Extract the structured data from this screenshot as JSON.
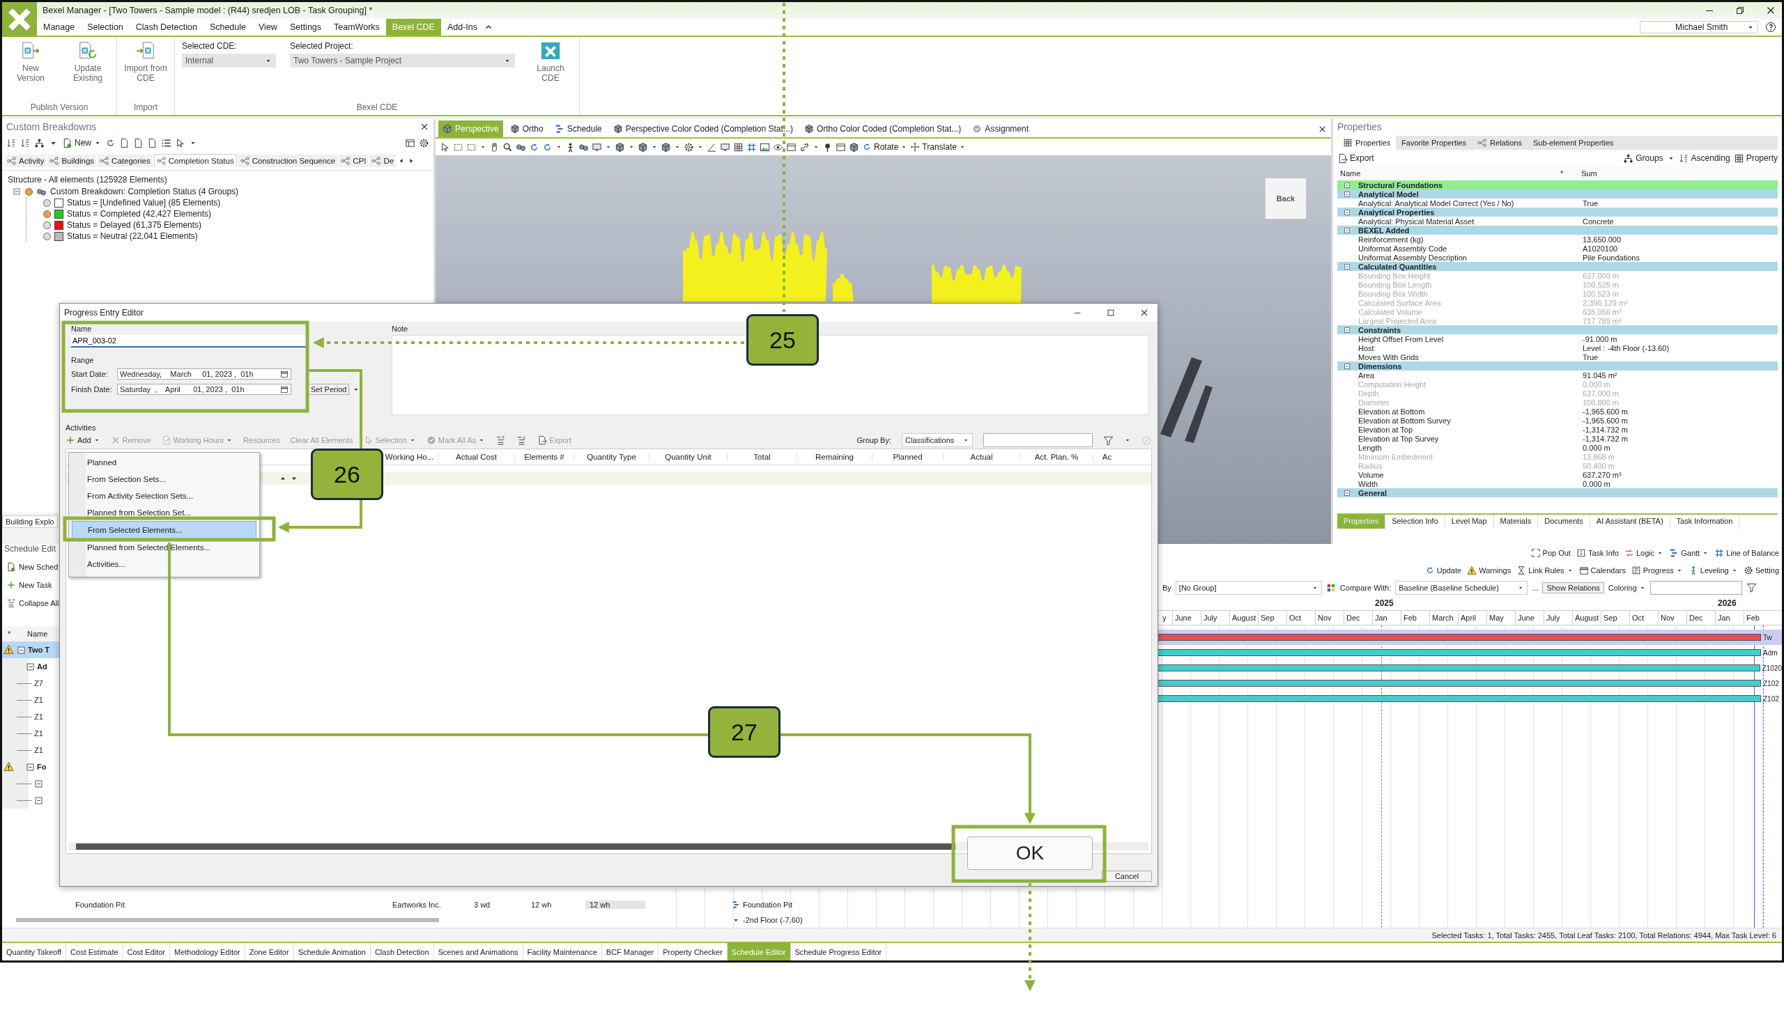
{
  "window": {
    "title": "Bexel Manager - [Two Towers - Sample model : (R44) sredjen LOB  - Task Grouping] *",
    "user": "Michael Smith"
  },
  "menu": [
    {
      "label": "Manage",
      "selected": false
    },
    {
      "label": "Selection",
      "selected": false
    },
    {
      "label": "Clash Detection",
      "selected": false
    },
    {
      "label": "Schedule",
      "selected": false
    },
    {
      "label": "View",
      "selected": false
    },
    {
      "label": "Settings",
      "selected": false
    },
    {
      "label": "TeamWorks",
      "selected": false
    },
    {
      "label": "Bexel CDE",
      "selected": true
    },
    {
      "label": "Add-Ins",
      "selected": false
    }
  ],
  "ribbon": [
    {
      "label": "Publish Version",
      "buttons": [
        {
          "label": "New Version",
          "kind": "new"
        },
        {
          "label": "Update Existing",
          "kind": "update"
        }
      ]
    },
    {
      "label": "Import",
      "buttons": [
        {
          "label": "Import from CDE",
          "kind": "import"
        }
      ]
    },
    {
      "label": "Bexel CDE",
      "fields": [
        {
          "label": "Selected CDE:",
          "value": "Internal",
          "disabled": true
        },
        {
          "label": "Selected Project:",
          "value": "Two Towers - Sample Project",
          "disabled": true
        }
      ],
      "buttons": [
        {
          "label": "Launch CDE",
          "kind": "launch"
        }
      ]
    }
  ],
  "breakdowns": {
    "title": "Custom Breakdowns",
    "new_label": "New",
    "tabs": [
      {
        "label": "Activity",
        "selected": false
      },
      {
        "label": "Buildings",
        "selected": false
      },
      {
        "label": "Categories",
        "selected": false
      },
      {
        "label": "Completion Status",
        "selected": true
      },
      {
        "label": "Construction Sequence",
        "selected": false
      },
      {
        "label": "CPI",
        "selected": false
      },
      {
        "label": "De",
        "selected": false
      }
    ],
    "structure": "Structure - All elements (125928 Elements)",
    "tree": [
      {
        "label": "Custom Breakdown: Completion Status (4 Groups)",
        "visible": true,
        "expanded": true,
        "children": [
          {
            "label": "Status = [Undefined Value] (85 Elements)",
            "visible": false,
            "color": "#ffffff"
          },
          {
            "label": "Status = Completed (42,427 Elements)",
            "visible": true,
            "color": "#22cc22"
          },
          {
            "label": "Status = Delayed (61,375 Elements)",
            "visible": false,
            "color": "#ee1111"
          },
          {
            "label": "Status = Neutral (22,041 Elements)",
            "visible": false,
            "color": "#bbbbbb"
          }
        ]
      }
    ]
  },
  "viewport": {
    "tabs": [
      {
        "label": "Perspective",
        "selected": true
      },
      {
        "label": "Ortho",
        "selected": false
      },
      {
        "label": "Schedule",
        "selected": false
      },
      {
        "label": "Perspective Color Coded (Completion Stat...)",
        "selected": false
      },
      {
        "label": "Ortho Color Coded (Completion Stat...)",
        "selected": false
      },
      {
        "label": "Assignment",
        "selected": false
      }
    ],
    "tools": [
      "Rotate",
      "Translate"
    ],
    "view_cube": "Back"
  },
  "properties": {
    "title": "Properties",
    "tabs": [
      {
        "label": "Properties",
        "selected": true
      },
      {
        "label": "Favorite Properties",
        "selected": false
      },
      {
        "label": "Relations",
        "selected": false
      },
      {
        "label": "Sub-element Properties",
        "selected": false
      }
    ],
    "export": "Export",
    "groups": "Groups",
    "ascending": "Ascending",
    "property": "Property",
    "columns": [
      "Name",
      "*",
      "Sum"
    ],
    "rows": [
      {
        "kind": "category",
        "name": "Structural Foundations"
      },
      {
        "kind": "group",
        "name": "Analytical Model"
      },
      {
        "kind": "value",
        "name": "Analytical: Analytical Model Correct (Yes / No)",
        "value": "True",
        "disabled": false
      },
      {
        "kind": "group",
        "name": "Analytical Properties"
      },
      {
        "kind": "value",
        "name": "Analytical: Physical Material Asset",
        "value": "Concrete",
        "disabled": false
      },
      {
        "kind": "group",
        "name": "BEXEL Added"
      },
      {
        "kind": "value",
        "name": "Reinforcement (kg)",
        "value": "13,650.000",
        "disabled": false
      },
      {
        "kind": "value",
        "name": "Uniformat Assembly Code",
        "value": "A1020100",
        "disabled": false
      },
      {
        "kind": "value",
        "name": "Uniformat Assembly Description",
        "value": "Pile Foundations",
        "disabled": false
      },
      {
        "kind": "group",
        "name": "Calculated Quantities"
      },
      {
        "kind": "value",
        "name": "Bounding Box Height",
        "value": "637.000 m",
        "disabled": true
      },
      {
        "kind": "value",
        "name": "Bounding Box Length",
        "value": "100.525 m",
        "disabled": true
      },
      {
        "kind": "value",
        "name": "Bounding Box Width",
        "value": "100.523 m",
        "disabled": true
      },
      {
        "kind": "value",
        "name": "Calculated Surface Area",
        "value": "2,396.129 m²",
        "disabled": true
      },
      {
        "kind": "value",
        "name": "Calculated Volume",
        "value": "635.056 m³",
        "disabled": true
      },
      {
        "kind": "value",
        "name": "Largest Projected Area",
        "value": "717.789 m²",
        "disabled": true
      },
      {
        "kind": "group",
        "name": "Constraints"
      },
      {
        "kind": "value",
        "name": "Height Offset From Level",
        "value": "-91.000 m",
        "disabled": false
      },
      {
        "kind": "value",
        "name": "Host",
        "value": "Level : -4th Floor (-13.60)",
        "disabled": false
      },
      {
        "kind": "value",
        "name": "Moves With Grids",
        "value": "True",
        "disabled": false
      },
      {
        "kind": "group",
        "name": "Dimensions"
      },
      {
        "kind": "value",
        "name": "Area",
        "value": "91.045 m²",
        "disabled": false
      },
      {
        "kind": "value",
        "name": "Computation Height",
        "value": "0.000 m",
        "disabled": true
      },
      {
        "kind": "value",
        "name": "Depth",
        "value": "637.000 m",
        "disabled": true
      },
      {
        "kind": "value",
        "name": "Diameter",
        "value": "100.800 m",
        "disabled": true
      },
      {
        "kind": "value",
        "name": "Elevation at Bottom",
        "value": "-1,965.600 m",
        "disabled": false
      },
      {
        "kind": "value",
        "name": "Elevation at Bottom Survey",
        "value": "-1,965.600 m",
        "disabled": false
      },
      {
        "kind": "value",
        "name": "Elevation at Top",
        "value": "-1,314.732 m",
        "disabled": false
      },
      {
        "kind": "value",
        "name": "Elevation at Top Survey",
        "value": "-1,314.732 m",
        "disabled": false
      },
      {
        "kind": "value",
        "name": "Length",
        "value": "0.000 m",
        "disabled": false
      },
      {
        "kind": "value",
        "name": "Minimum Embedment",
        "value": "13.868 m",
        "disabled": true
      },
      {
        "kind": "value",
        "name": "Radius",
        "value": "50.400 m",
        "disabled": true
      },
      {
        "kind": "value",
        "name": "Volume",
        "value": "637.270 m³",
        "disabled": false
      },
      {
        "kind": "value",
        "name": "Width",
        "value": "0.000 m",
        "disabled": false
      },
      {
        "kind": "group",
        "name": "General"
      }
    ],
    "bottom_tabs": [
      {
        "label": "Properties",
        "selected": true
      },
      {
        "label": "Selection Info",
        "selected": false
      },
      {
        "label": "Level Map",
        "selected": false
      },
      {
        "label": "Materials",
        "selected": false
      },
      {
        "label": "Documents",
        "selected": false
      },
      {
        "label": "AI Assistant (BETA)",
        "selected": false
      },
      {
        "label": "Task Information",
        "selected": false
      }
    ]
  },
  "explorer_tabs": [
    {
      "label": "Building Explo",
      "selected": false
    }
  ],
  "schedule": {
    "title": "Schedule Edit",
    "actions": [
      {
        "label": "New Sched",
        "kind": "new"
      },
      {
        "label": "New Task",
        "kind": "add"
      },
      {
        "label": "Collapse All",
        "kind": "collapse"
      }
    ],
    "columns": [
      "*",
      "Name"
    ],
    "tree": [
      {
        "label": "Two T",
        "warning": true,
        "selected": true,
        "expanded": true,
        "children": [
          {
            "label": "Ad",
            "warning": false,
            "selected": false,
            "expanded": true,
            "children": [
              {
                "label": "Z7"
              },
              {
                "label": "Z1"
              },
              {
                "label": "Z1"
              },
              {
                "label": "Z1"
              },
              {
                "label": "Z1"
              }
            ]
          },
          {
            "label": "Fo",
            "warning": true,
            "selected": false,
            "expanded": true,
            "children": [
              {
                "expanded": true
              },
              {
                "expanded": true
              }
            ]
          }
        ]
      }
    ],
    "footer_row": [
      "Foundation Pit",
      "Eartworks Inc.",
      "3 wd",
      "12 wh",
      "12 wh"
    ]
  },
  "gantt": {
    "toolbar1": [
      {
        "label": "Pop Out",
        "kind": "popout",
        "dropdown": false
      },
      {
        "label": "Task Info",
        "kind": "info",
        "dropdown": false
      },
      {
        "label": "Logic",
        "kind": "logic",
        "dropdown": true
      },
      {
        "label": "Gantt",
        "kind": "gantt",
        "dropdown": true
      },
      {
        "label": "Line of Balance",
        "kind": "lob",
        "dropdown": false
      }
    ],
    "toolbar2": [
      {
        "label": "Update",
        "kind": "update",
        "dropdown": false
      },
      {
        "label": "Warnings",
        "kind": "warning",
        "dropdown": false
      },
      {
        "label": "Link Rules",
        "kind": "linkrule",
        "dropdown": true
      },
      {
        "label": "Calendars",
        "kind": "calendar",
        "dropdown": false
      },
      {
        "label": "Progress",
        "kind": "progress",
        "dropdown": true
      },
      {
        "label": "Leveling",
        "kind": "leveling",
        "dropdown": true
      },
      {
        "label": "Setting",
        "kind": "gear",
        "dropdown": false
      }
    ],
    "group_by_label": "By",
    "group_by": "[No Group]",
    "compare_label": "Compare With:",
    "compare": "Baseline (Baseline Schedule)",
    "more": "...",
    "show_relations": "Show Relations",
    "coloring": "Coloring",
    "months": [
      {
        "label": "y"
      },
      {
        "label": "June"
      },
      {
        "label": "July"
      },
      {
        "label": "August"
      },
      {
        "label": "Sep"
      },
      {
        "label": "Oct"
      },
      {
        "label": "Nov"
      },
      {
        "label": "Dec"
      },
      {
        "label": "Jan",
        "year": "2025"
      },
      {
        "label": "Feb"
      },
      {
        "label": "March"
      },
      {
        "label": "April"
      },
      {
        "label": "May"
      },
      {
        "label": "June"
      },
      {
        "label": "July"
      },
      {
        "label": "August"
      },
      {
        "label": "Sep"
      },
      {
        "label": "Oct"
      },
      {
        "label": "Nov"
      },
      {
        "label": "Dec"
      },
      {
        "label": "Jan",
        "year": "2026"
      },
      {
        "label": "Feb"
      }
    ],
    "rows": [
      {
        "label": "Tw",
        "selected": true,
        "color": "#e0505a"
      },
      {
        "label": "Adm",
        "selected": false,
        "color": "#45cccc"
      },
      {
        "label": "Z1020",
        "selected": false,
        "color": "#45cccc"
      },
      {
        "label": "Z102",
        "selected": false,
        "color": "#45cccc"
      },
      {
        "label": "Z102",
        "selected": false,
        "color": "#45cccc"
      }
    ],
    "labels": [
      "Foundation Pit",
      "-2nd Floor (-7.60)"
    ]
  },
  "dialog": {
    "title": "Progress Entry Editor",
    "name_label": "Name",
    "name": "APR_003-02",
    "note_label": "Note",
    "range_label": "Range",
    "start_label": "Start Date:",
    "start": "Wednesday,    March     01, 2023 ,  01h",
    "finish_label": "Finish Date:",
    "finish": "Saturday  ,    April      01, 2023 ,  01h",
    "set_period": "Set Period",
    "activities_label": "Activities",
    "toolbar": [
      {
        "label": "Add",
        "kind": "add",
        "disabled": false,
        "dropdown": true
      },
      {
        "label": "Remove",
        "kind": "remove",
        "disabled": true,
        "dropdown": false
      },
      {
        "label": "Working Hours",
        "kind": "hours",
        "disabled": true,
        "dropdown": true
      },
      {
        "label": "Resources",
        "kind": "text",
        "disabled": true,
        "dropdown": false
      },
      {
        "label": "Clear All Elements",
        "kind": "text",
        "disabled": true,
        "dropdown": false
      },
      {
        "label": "Selection",
        "kind": "selection",
        "disabled": true,
        "dropdown": true
      },
      {
        "label": "Mark All As",
        "kind": "mark",
        "disabled": true,
        "dropdown": true
      },
      {
        "kind": "expand",
        "disabled": false,
        "dropdown": false
      },
      {
        "kind": "collapse",
        "disabled": false,
        "dropdown": false
      },
      {
        "label": "Export",
        "kind": "export",
        "disabled": true,
        "dropdown": false
      }
    ],
    "group_by_label": "Group By:",
    "group_by": "Classifications",
    "columns": [
      "Working Ho...",
      "Actual Cost",
      "Elements #",
      "Quantity Type",
      "Quantity Unit",
      "Total",
      "Remaining",
      "Planned",
      "Actual",
      "Act. Plan. %",
      "Ac"
    ],
    "menu": [
      {
        "label": "Planned",
        "selected": false
      },
      {
        "label": "From Selection Sets...",
        "selected": false
      },
      {
        "label": "From Activity Selection Sets...",
        "selected": false
      },
      {
        "label": "Planned from Selection Set...",
        "selected": false
      },
      {
        "label": "From Selected Elements...",
        "selected": true
      },
      {
        "label": "Planned from Selected Elements...",
        "selected": false
      },
      {
        "label": "Activities...",
        "selected": false
      }
    ],
    "ok": "OK",
    "cancel": "Cancel"
  },
  "callouts": [
    {
      "label": "25"
    },
    {
      "label": "26"
    },
    {
      "label": "27"
    }
  ],
  "status": "Selected Tasks: 1, Total Tasks: 2455, Total Leaf Tasks: 2100, Total Relations: 4944, Max Task Level: 6",
  "bottom_tabs": [
    {
      "label": "Quantity Takeoff",
      "selected": false
    },
    {
      "label": "Cost Estimate",
      "selected": false
    },
    {
      "label": "Cost Editor",
      "selected": false
    },
    {
      "label": "Methodology Editor",
      "selected": false
    },
    {
      "label": "Zone Editor",
      "selected": false
    },
    {
      "label": "Schedule Animation",
      "selected": false
    },
    {
      "label": "Clash Detection",
      "selected": false
    },
    {
      "label": "Scenes and Animations",
      "selected": false
    },
    {
      "label": "Facility Maintenance",
      "selected": false
    },
    {
      "label": "BCF Manager",
      "selected": false
    },
    {
      "label": "Property Checker",
      "selected": false
    },
    {
      "label": "Schedule Editor",
      "selected": true
    },
    {
      "label": "Schedule Progress Editor",
      "selected": false
    }
  ]
}
